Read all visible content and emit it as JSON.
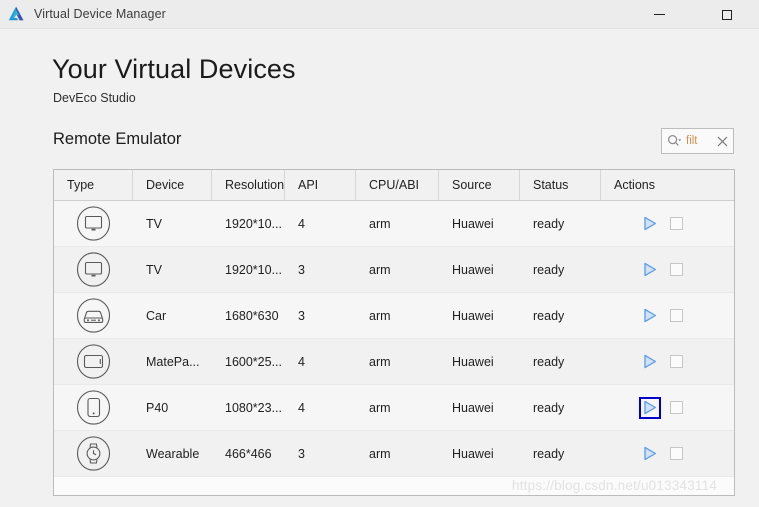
{
  "window": {
    "title": "Virtual Device Manager",
    "app_icon": "deveco-studio-logo-icon",
    "controls": {
      "minimize": "minimize-icon",
      "maximize": "maximize-icon"
    }
  },
  "header": {
    "title": "Your Virtual Devices",
    "subtitle": "DevEco Studio"
  },
  "section": {
    "title": "Remote Emulator"
  },
  "filter": {
    "search_icon": "search-dropdown-icon",
    "value": "filt",
    "placeholder": "filt",
    "clear_icon": "close-icon"
  },
  "table": {
    "columns": [
      {
        "key": "type",
        "label": "Type"
      },
      {
        "key": "device",
        "label": "Device"
      },
      {
        "key": "resolution",
        "label": "Resolution"
      },
      {
        "key": "api",
        "label": "API"
      },
      {
        "key": "cpu_abi",
        "label": "CPU/ABI"
      },
      {
        "key": "source",
        "label": "Source"
      },
      {
        "key": "status",
        "label": "Status"
      },
      {
        "key": "actions",
        "label": "Actions"
      }
    ],
    "rows": [
      {
        "icon": "tv-icon",
        "device": "TV",
        "resolution": "1920*10...",
        "api": "4",
        "cpu_abi": "arm",
        "source": "Huawei",
        "status": "ready",
        "play_icon": "play-icon",
        "play_focused": false,
        "checkbox": "checkbox-unchecked"
      },
      {
        "icon": "tv-icon",
        "device": "TV",
        "resolution": "1920*10...",
        "api": "3",
        "cpu_abi": "arm",
        "source": "Huawei",
        "status": "ready",
        "play_icon": "play-icon",
        "play_focused": false,
        "checkbox": "checkbox-unchecked"
      },
      {
        "icon": "car-icon",
        "device": "Car",
        "resolution": "1680*630",
        "api": "3",
        "cpu_abi": "arm",
        "source": "Huawei",
        "status": "ready",
        "play_icon": "play-icon",
        "play_focused": false,
        "checkbox": "checkbox-unchecked"
      },
      {
        "icon": "tablet-icon",
        "device": "MatePa...",
        "resolution": "1600*25...",
        "api": "4",
        "cpu_abi": "arm",
        "source": "Huawei",
        "status": "ready",
        "play_icon": "play-icon",
        "play_focused": false,
        "checkbox": "checkbox-unchecked"
      },
      {
        "icon": "phone-icon",
        "device": "P40",
        "resolution": "1080*23...",
        "api": "4",
        "cpu_abi": "arm",
        "source": "Huawei",
        "status": "ready",
        "play_icon": "play-icon",
        "play_focused": true,
        "checkbox": "checkbox-unchecked"
      },
      {
        "icon": "watch-icon",
        "device": "Wearable",
        "resolution": "466*466",
        "api": "3",
        "cpu_abi": "arm",
        "source": "Huawei",
        "status": "ready",
        "play_icon": "play-icon",
        "play_focused": false,
        "checkbox": "checkbox-unchecked"
      }
    ]
  },
  "watermark": {
    "text": "https://blog.csdn.net/u013343114"
  },
  "colors": {
    "accent_blue": "#5b9be8",
    "focus_blue": "#0000cd",
    "window_bg": "#f1f1f1",
    "titlebar_bg": "#ececec",
    "table_border": "#bcbcbc",
    "filter_text": "#d98f4e"
  }
}
